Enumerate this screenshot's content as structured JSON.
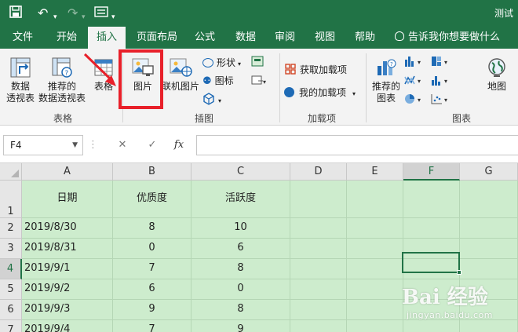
{
  "window": {
    "title": "测试"
  },
  "menu": {
    "tabs": [
      {
        "label": "文件"
      },
      {
        "label": "开始"
      },
      {
        "label": "插入"
      },
      {
        "label": "页面布局"
      },
      {
        "label": "公式"
      },
      {
        "label": "数据"
      },
      {
        "label": "审阅"
      },
      {
        "label": "视图"
      },
      {
        "label": "帮助"
      }
    ],
    "active": "插入",
    "tell_me": "告诉我你想要做什么"
  },
  "ribbon": {
    "tables": {
      "pivot_l1": "数据",
      "pivot_l2": "透视表",
      "recpivot_l1": "推荐的",
      "recpivot_l2": "数据透视表",
      "table": "表格",
      "group": "表格"
    },
    "illustrations": {
      "pictures": "图片",
      "online_pictures": "联机图片",
      "shapes": "形状",
      "icons": "图标",
      "group": "插图"
    },
    "addins": {
      "get": "获取加载项",
      "mine": "我的加载项",
      "group": "加载项"
    },
    "charts": {
      "rec_l1": "推荐的",
      "rec_l2": "图表",
      "maps": "地图",
      "group": "图表"
    }
  },
  "formula_bar": {
    "name_box": "F4",
    "cancel": "✕",
    "enter": "✓",
    "fx": "fx",
    "value": ""
  },
  "sheet": {
    "columns": [
      "A",
      "B",
      "C",
      "D",
      "E",
      "F",
      "G"
    ],
    "selected_column": "F",
    "selected_row": "4",
    "rows": [
      {
        "num": "1",
        "a": "日期",
        "b": "优质度",
        "c": "活跃度"
      },
      {
        "num": "2",
        "a": "2019/8/30",
        "b": "8",
        "c": "10"
      },
      {
        "num": "3",
        "a": "2019/8/31",
        "b": "0",
        "c": "6"
      },
      {
        "num": "4",
        "a": "2019/9/1",
        "b": "7",
        "c": "8"
      },
      {
        "num": "5",
        "a": "2019/9/2",
        "b": "6",
        "c": "0"
      },
      {
        "num": "6",
        "a": "2019/9/3",
        "b": "9",
        "c": "8"
      },
      {
        "num": "7",
        "a": "2019/9/4",
        "b": "7",
        "c": "9"
      }
    ]
  },
  "watermark": {
    "main": "Bai 经验",
    "sub": "jingyan.baidu.com"
  },
  "colors": {
    "accent": "#217346",
    "highlight": "#e8202a",
    "cell_fill": "#cdeccd"
  }
}
